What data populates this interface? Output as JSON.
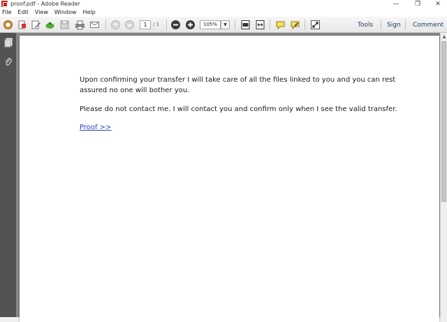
{
  "window": {
    "title": "proof.pdf - Adobe Reader",
    "minimize_glyph": "—",
    "maximize_glyph": "❐",
    "close_glyph": "✕"
  },
  "menu": [
    "File",
    "Edit",
    "View",
    "Window",
    "Help"
  ],
  "toolbar": {
    "page_current": "1",
    "page_total": "/ 1",
    "zoom": "105%",
    "zoom_drop_glyph": "▼",
    "tools_label": "Tools",
    "sign_label": "Sign",
    "comment_label": "Comment",
    "icons": [
      "create-pdf-icon",
      "share-icon",
      "edit-icon",
      "upload-icon",
      "save-icon",
      "print-icon",
      "email-icon",
      "previous-page-icon",
      "next-page-icon",
      "zoom-out-icon",
      "zoom-in-icon",
      "fit-page-icon",
      "fit-width-icon",
      "comment-icon",
      "highlight-icon",
      "full-screen-icon"
    ]
  },
  "nav": {
    "icons": [
      "pages-icon",
      "attachments-icon"
    ]
  },
  "document": {
    "paragraph1": "Upon confirming your transfer I will take care of all the files linked to you and you can rest assured no one will bother you.",
    "paragraph2": "Please do not contact me. I will contact you and confirm only when I see the valid transfer.",
    "link_text": "Proof  >>"
  },
  "scrollbar": {
    "up_glyph": "▲"
  },
  "colors": {
    "accent_link": "#2a3fc7",
    "nav_pane": "#535353",
    "doc_background": "#888888",
    "right_buttons": "#1f3d63"
  }
}
